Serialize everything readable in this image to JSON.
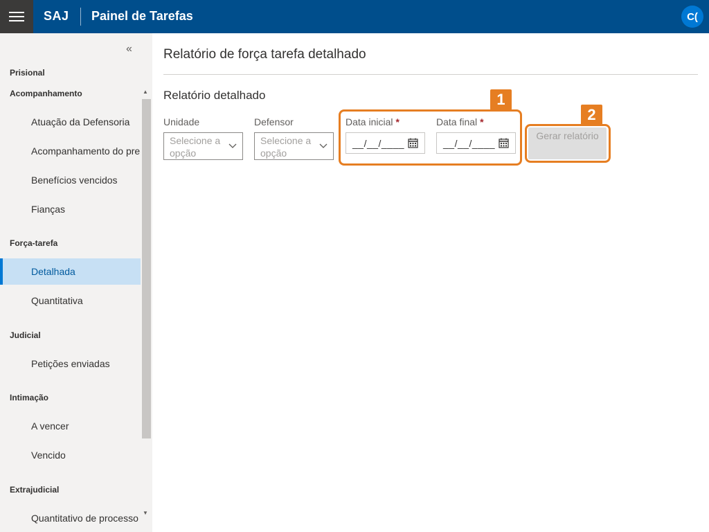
{
  "topbar": {
    "brand": "SAJ",
    "title": "Painel de Tarefas",
    "avatar_initials": "C("
  },
  "sidebar": {
    "collapse_glyph": "«",
    "groups": {
      "prisional": "Prisional",
      "acompanhamento": "Acompanhamento",
      "forca_tarefa": "Força-tarefa",
      "judicial": "Judicial",
      "intimacao": "Intimação",
      "extrajudicial": "Extrajudicial"
    },
    "items": {
      "atuacao": "Atuação da Defensoria",
      "acompanhamento_pre": "Acompanhamento do pre",
      "beneficios": "Benefícios vencidos",
      "fiancas": "Fianças",
      "detalhada": "Detalhada",
      "quantitativa": "Quantitativa",
      "peticoes": "Petições enviadas",
      "a_vencer": "A vencer",
      "vencido": "Vencido",
      "quantitativo_processo": "Quantitativo de processo"
    },
    "active_item": "Detalhada"
  },
  "main": {
    "page_title": "Relatório de força tarefa detalhado",
    "section_title": "Relatório detalhado",
    "unidade": {
      "label": "Unidade",
      "placeholder": "Selecione a opção"
    },
    "defensor": {
      "label": "Defensor",
      "placeholder": "Selecione a opção"
    },
    "data_inicial": {
      "label": "Data inicial",
      "required_mark": "*",
      "mask": "__/__/____"
    },
    "data_final": {
      "label": "Data final",
      "required_mark": "*",
      "mask": "__/__/____"
    },
    "generate_button": "Gerar relatório"
  },
  "annotations": [
    {
      "number": "1"
    },
    {
      "number": "2"
    }
  ],
  "colors": {
    "topbar": "#004e8c",
    "accent": "#0078d4",
    "highlight": "#e67e22",
    "required": "#a4262c"
  }
}
